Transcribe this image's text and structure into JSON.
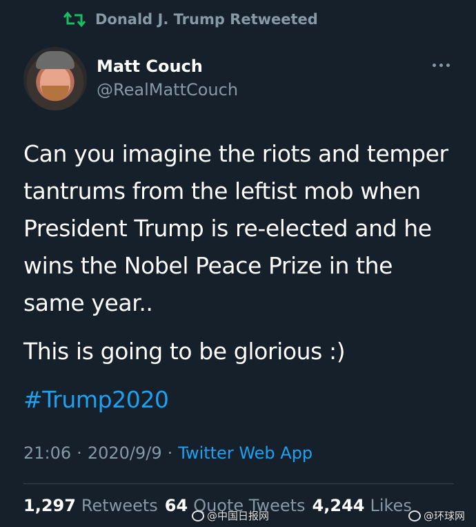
{
  "retweet_banner": {
    "text": "Donald J. Trump Retweeted",
    "icon": "retweet-icon"
  },
  "author": {
    "display_name": "Matt Couch",
    "handle": "@RealMattCouch"
  },
  "tweet": {
    "body": "Can you imagine the riots and temper tantrums from the leftist mob when President Trump is re-elected and he wins the Nobel Peace Prize in the same year..",
    "body2": "This is going to be glorious :)",
    "hashtag": "#Trump2020"
  },
  "meta": {
    "time": "21:06",
    "separator1": "·",
    "date": "2020/9/9",
    "separator2": "·",
    "source": "Twitter Web App"
  },
  "stats": {
    "retweets_count": "1,297",
    "retweets_label": "Retweets",
    "quote_count": "64",
    "quote_label": "Quote Tweets",
    "likes_count": "4,244",
    "likes_label": "Likes"
  },
  "watermarks": {
    "left": "@中国日报网",
    "right": "@环球网"
  },
  "colors": {
    "background": "#15202b",
    "accent": "#1da1f2",
    "muted": "#8899a6",
    "retweet_green": "#17bf63"
  }
}
